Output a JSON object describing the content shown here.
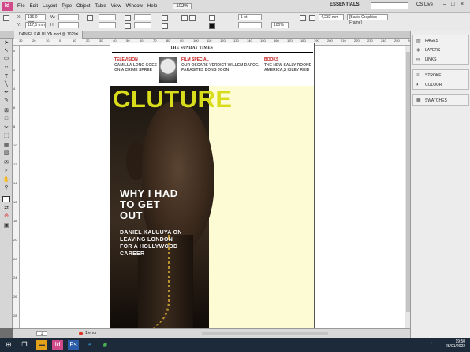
{
  "menubar": {
    "app_logo": "Id",
    "items": [
      "File",
      "Edit",
      "Layout",
      "Type",
      "Object",
      "Table",
      "View",
      "Window",
      "Help"
    ],
    "zoom": "102%",
    "workspace": "ESSENTIALS",
    "cs_live": "CS Live"
  },
  "controlbar": {
    "x_label": "X:",
    "x_value": "136,0 mm",
    "y_label": "Y:",
    "y_value": "117,5 mm",
    "w_label": "W:",
    "h_label": "H:",
    "stroke_weight": "1 pt",
    "opacity": "100%",
    "dimension": "4,233 mm",
    "frame_style": "[Basic Graphics Frame]"
  },
  "document_tab": {
    "label": "DANIEL KALUUYA.indd @ 102%",
    "close": "×"
  },
  "ruler_top": [
    "30",
    "20",
    "10",
    "0",
    "10",
    "20",
    "30",
    "40",
    "50",
    "60",
    "70",
    "80",
    "90",
    "100",
    "110",
    "120",
    "130",
    "140",
    "150",
    "160",
    "170",
    "180",
    "190",
    "200",
    "210",
    "220",
    "230",
    "240",
    "250",
    "260"
  ],
  "ruler_left": [
    "0",
    "2",
    "4",
    "6",
    "8",
    "10",
    "12",
    "14",
    "16",
    "18",
    "20",
    "22",
    "24",
    "26",
    "28"
  ],
  "page": {
    "masthead": "THE SUNDAY TIMES",
    "teasers": [
      {
        "head": "TELEVISION",
        "body": "CAMILLA LONG GOES ON A CRIME SPREE"
      },
      {
        "head": "FILM SPECIAL",
        "body": "OUR OSCARS VERDICT WILLEM DAFOE, PARASITES BONG JOON"
      },
      {
        "head": "BOOKS",
        "body": "THE NEW SALLY ROONE AMERICA,S KILEY REID"
      }
    ],
    "title": "CLUTURE",
    "headline": "WHY I HAD TO GET OUT",
    "subhead": "DANIEL KALUUYA ON LEAVING LONDON FOR A HOLLYWOOD CAREER",
    "colors": {
      "title": "#d8dc1a",
      "background": "#fdfbd4",
      "teaser_head": "#c41b1b"
    }
  },
  "status": {
    "page_number": "1",
    "error_text": "1 error"
  },
  "panels": [
    {
      "group": "pages",
      "items": [
        {
          "icon": "pages-icon",
          "glyph": "▤",
          "label": "PAGES"
        },
        {
          "icon": "layers-icon",
          "glyph": "◈",
          "label": "LAYERS"
        },
        {
          "icon": "links-icon",
          "glyph": "∞",
          "label": "LINKS"
        }
      ]
    },
    {
      "group": "stroke",
      "items": [
        {
          "icon": "stroke-icon",
          "glyph": "≡",
          "label": "STROKE"
        },
        {
          "icon": "colour-icon",
          "glyph": "◐",
          "label": "COLOUR"
        }
      ]
    },
    {
      "group": "swatches",
      "items": [
        {
          "icon": "swatches-icon",
          "glyph": "▦",
          "label": "SWATCHES"
        }
      ]
    }
  ],
  "taskbar": {
    "time": "19:50",
    "date": "28/01/2022"
  }
}
